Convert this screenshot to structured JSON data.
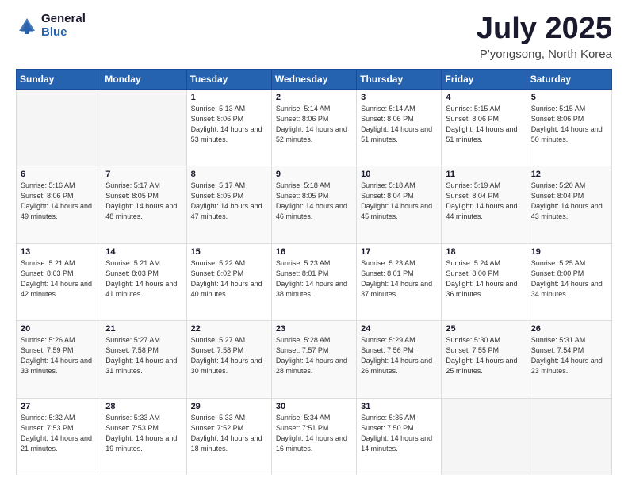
{
  "logo": {
    "general": "General",
    "blue": "Blue"
  },
  "header": {
    "month": "July 2025",
    "location": "P'yongsong, North Korea"
  },
  "weekdays": [
    "Sunday",
    "Monday",
    "Tuesday",
    "Wednesday",
    "Thursday",
    "Friday",
    "Saturday"
  ],
  "weeks": [
    [
      null,
      null,
      {
        "day": 1,
        "sunrise": "Sunrise: 5:13 AM",
        "sunset": "Sunset: 8:06 PM",
        "daylight": "Daylight: 14 hours and 53 minutes."
      },
      {
        "day": 2,
        "sunrise": "Sunrise: 5:14 AM",
        "sunset": "Sunset: 8:06 PM",
        "daylight": "Daylight: 14 hours and 52 minutes."
      },
      {
        "day": 3,
        "sunrise": "Sunrise: 5:14 AM",
        "sunset": "Sunset: 8:06 PM",
        "daylight": "Daylight: 14 hours and 51 minutes."
      },
      {
        "day": 4,
        "sunrise": "Sunrise: 5:15 AM",
        "sunset": "Sunset: 8:06 PM",
        "daylight": "Daylight: 14 hours and 51 minutes."
      },
      {
        "day": 5,
        "sunrise": "Sunrise: 5:15 AM",
        "sunset": "Sunset: 8:06 PM",
        "daylight": "Daylight: 14 hours and 50 minutes."
      }
    ],
    [
      {
        "day": 6,
        "sunrise": "Sunrise: 5:16 AM",
        "sunset": "Sunset: 8:06 PM",
        "daylight": "Daylight: 14 hours and 49 minutes."
      },
      {
        "day": 7,
        "sunrise": "Sunrise: 5:17 AM",
        "sunset": "Sunset: 8:05 PM",
        "daylight": "Daylight: 14 hours and 48 minutes."
      },
      {
        "day": 8,
        "sunrise": "Sunrise: 5:17 AM",
        "sunset": "Sunset: 8:05 PM",
        "daylight": "Daylight: 14 hours and 47 minutes."
      },
      {
        "day": 9,
        "sunrise": "Sunrise: 5:18 AM",
        "sunset": "Sunset: 8:05 PM",
        "daylight": "Daylight: 14 hours and 46 minutes."
      },
      {
        "day": 10,
        "sunrise": "Sunrise: 5:18 AM",
        "sunset": "Sunset: 8:04 PM",
        "daylight": "Daylight: 14 hours and 45 minutes."
      },
      {
        "day": 11,
        "sunrise": "Sunrise: 5:19 AM",
        "sunset": "Sunset: 8:04 PM",
        "daylight": "Daylight: 14 hours and 44 minutes."
      },
      {
        "day": 12,
        "sunrise": "Sunrise: 5:20 AM",
        "sunset": "Sunset: 8:04 PM",
        "daylight": "Daylight: 14 hours and 43 minutes."
      }
    ],
    [
      {
        "day": 13,
        "sunrise": "Sunrise: 5:21 AM",
        "sunset": "Sunset: 8:03 PM",
        "daylight": "Daylight: 14 hours and 42 minutes."
      },
      {
        "day": 14,
        "sunrise": "Sunrise: 5:21 AM",
        "sunset": "Sunset: 8:03 PM",
        "daylight": "Daylight: 14 hours and 41 minutes."
      },
      {
        "day": 15,
        "sunrise": "Sunrise: 5:22 AM",
        "sunset": "Sunset: 8:02 PM",
        "daylight": "Daylight: 14 hours and 40 minutes."
      },
      {
        "day": 16,
        "sunrise": "Sunrise: 5:23 AM",
        "sunset": "Sunset: 8:01 PM",
        "daylight": "Daylight: 14 hours and 38 minutes."
      },
      {
        "day": 17,
        "sunrise": "Sunrise: 5:23 AM",
        "sunset": "Sunset: 8:01 PM",
        "daylight": "Daylight: 14 hours and 37 minutes."
      },
      {
        "day": 18,
        "sunrise": "Sunrise: 5:24 AM",
        "sunset": "Sunset: 8:00 PM",
        "daylight": "Daylight: 14 hours and 36 minutes."
      },
      {
        "day": 19,
        "sunrise": "Sunrise: 5:25 AM",
        "sunset": "Sunset: 8:00 PM",
        "daylight": "Daylight: 14 hours and 34 minutes."
      }
    ],
    [
      {
        "day": 20,
        "sunrise": "Sunrise: 5:26 AM",
        "sunset": "Sunset: 7:59 PM",
        "daylight": "Daylight: 14 hours and 33 minutes."
      },
      {
        "day": 21,
        "sunrise": "Sunrise: 5:27 AM",
        "sunset": "Sunset: 7:58 PM",
        "daylight": "Daylight: 14 hours and 31 minutes."
      },
      {
        "day": 22,
        "sunrise": "Sunrise: 5:27 AM",
        "sunset": "Sunset: 7:58 PM",
        "daylight": "Daylight: 14 hours and 30 minutes."
      },
      {
        "day": 23,
        "sunrise": "Sunrise: 5:28 AM",
        "sunset": "Sunset: 7:57 PM",
        "daylight": "Daylight: 14 hours and 28 minutes."
      },
      {
        "day": 24,
        "sunrise": "Sunrise: 5:29 AM",
        "sunset": "Sunset: 7:56 PM",
        "daylight": "Daylight: 14 hours and 26 minutes."
      },
      {
        "day": 25,
        "sunrise": "Sunrise: 5:30 AM",
        "sunset": "Sunset: 7:55 PM",
        "daylight": "Daylight: 14 hours and 25 minutes."
      },
      {
        "day": 26,
        "sunrise": "Sunrise: 5:31 AM",
        "sunset": "Sunset: 7:54 PM",
        "daylight": "Daylight: 14 hours and 23 minutes."
      }
    ],
    [
      {
        "day": 27,
        "sunrise": "Sunrise: 5:32 AM",
        "sunset": "Sunset: 7:53 PM",
        "daylight": "Daylight: 14 hours and 21 minutes."
      },
      {
        "day": 28,
        "sunrise": "Sunrise: 5:33 AM",
        "sunset": "Sunset: 7:53 PM",
        "daylight": "Daylight: 14 hours and 19 minutes."
      },
      {
        "day": 29,
        "sunrise": "Sunrise: 5:33 AM",
        "sunset": "Sunset: 7:52 PM",
        "daylight": "Daylight: 14 hours and 18 minutes."
      },
      {
        "day": 30,
        "sunrise": "Sunrise: 5:34 AM",
        "sunset": "Sunset: 7:51 PM",
        "daylight": "Daylight: 14 hours and 16 minutes."
      },
      {
        "day": 31,
        "sunrise": "Sunrise: 5:35 AM",
        "sunset": "Sunset: 7:50 PM",
        "daylight": "Daylight: 14 hours and 14 minutes."
      },
      null,
      null
    ]
  ]
}
